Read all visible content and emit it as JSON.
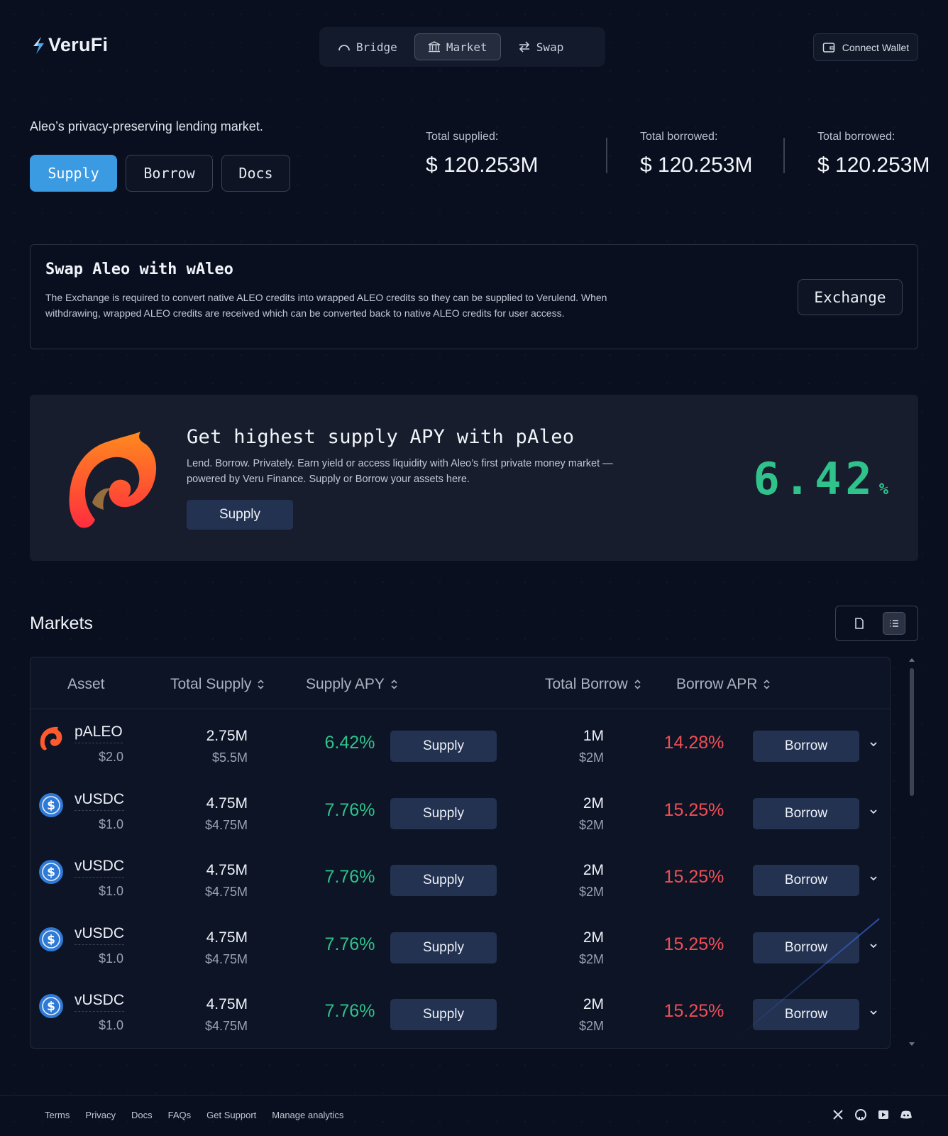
{
  "header": {
    "brand": "VeruFi",
    "nav": [
      {
        "label": "Bridge",
        "icon": "arc-icon"
      },
      {
        "label": "Market",
        "icon": "bank-icon"
      },
      {
        "label": "Swap",
        "icon": "swap-arrows-icon"
      }
    ],
    "connect_wallet": "Connect Wallet"
  },
  "hero": {
    "tagline": "Aleo’s privacy-preserving lending market.",
    "buttons": {
      "supply": "Supply",
      "borrow": "Borrow",
      "docs": "Docs"
    },
    "stats": [
      {
        "label": "Total supplied:",
        "value": "$ 120.253M"
      },
      {
        "label": "Total borrowed:",
        "value": "$ 120.253M"
      },
      {
        "label": "Total borrowed:",
        "value": "$ 120.253M"
      }
    ]
  },
  "swap_card": {
    "title": "Swap Aleo with wAleo",
    "description": "The Exchange is required to convert native ALEO credits into wrapped ALEO credits so they can be supplied to Verulend. When withdrawing, wrapped ALEO credits are received which can be converted back to native ALEO credits for user access.",
    "button": "Exchange"
  },
  "promo": {
    "title": "Get highest supply APY with pAleo",
    "description": "Lend. Borrow. Privately. Earn yield or access liquidity with Aleo’s first private money market — powered by Veru Finance. Supply or Borrow your assets here.",
    "button": "Supply",
    "apy_value": "6.42",
    "apy_unit": "%"
  },
  "markets": {
    "title": "Markets",
    "columns": {
      "asset": "Asset",
      "total_supply": "Total Supply",
      "supply_apy": "Supply APY",
      "total_borrow": "Total Borrow",
      "borrow_apr": "Borrow APR"
    },
    "rows": [
      {
        "asset": "pALEO",
        "price": "$2.0",
        "total_supply": "2.75M",
        "total_supply_usd": "$5.5M",
        "supply_apy": "6.42%",
        "supply_btn": "Supply",
        "total_borrow": "1M",
        "total_borrow_usd": "$2M",
        "borrow_apr": "14.28%",
        "borrow_btn": "Borrow",
        "icon": "paleo-icon"
      },
      {
        "asset": "vUSDC",
        "price": "$1.0",
        "total_supply": "4.75M",
        "total_supply_usd": "$4.75M",
        "supply_apy": "7.76%",
        "supply_btn": "Supply",
        "total_borrow": "2M",
        "total_borrow_usd": "$2M",
        "borrow_apr": "15.25%",
        "borrow_btn": "Borrow",
        "icon": "usdc-icon"
      },
      {
        "asset": "vUSDC",
        "price": "$1.0",
        "total_supply": "4.75M",
        "total_supply_usd": "$4.75M",
        "supply_apy": "7.76%",
        "supply_btn": "Supply",
        "total_borrow": "2M",
        "total_borrow_usd": "$2M",
        "borrow_apr": "15.25%",
        "borrow_btn": "Borrow",
        "icon": "usdc-icon"
      },
      {
        "asset": "vUSDC",
        "price": "$1.0",
        "total_supply": "4.75M",
        "total_supply_usd": "$4.75M",
        "supply_apy": "7.76%",
        "supply_btn": "Supply",
        "total_borrow": "2M",
        "total_borrow_usd": "$2M",
        "borrow_apr": "15.25%",
        "borrow_btn": "Borrow",
        "icon": "usdc-icon"
      },
      {
        "asset": "vUSDC",
        "price": "$1.0",
        "total_supply": "4.75M",
        "total_supply_usd": "$4.75M",
        "supply_apy": "7.76%",
        "supply_btn": "Supply",
        "total_borrow": "2M",
        "total_borrow_usd": "$2M",
        "borrow_apr": "15.25%",
        "borrow_btn": "Borrow",
        "icon": "usdc-icon"
      }
    ]
  },
  "footer": {
    "links": [
      "Terms",
      "Privacy",
      "Docs",
      "FAQs",
      "Get Support",
      "Manage analytics"
    ],
    "socials": [
      "x-icon",
      "github-icon",
      "youtube-icon",
      "discord-icon"
    ]
  },
  "colors": {
    "accent": "#3a9ae2",
    "positive": "#2fc28a",
    "negative": "#ef4f55",
    "button_dark": "#233251",
    "background": "#0a0f1f"
  }
}
